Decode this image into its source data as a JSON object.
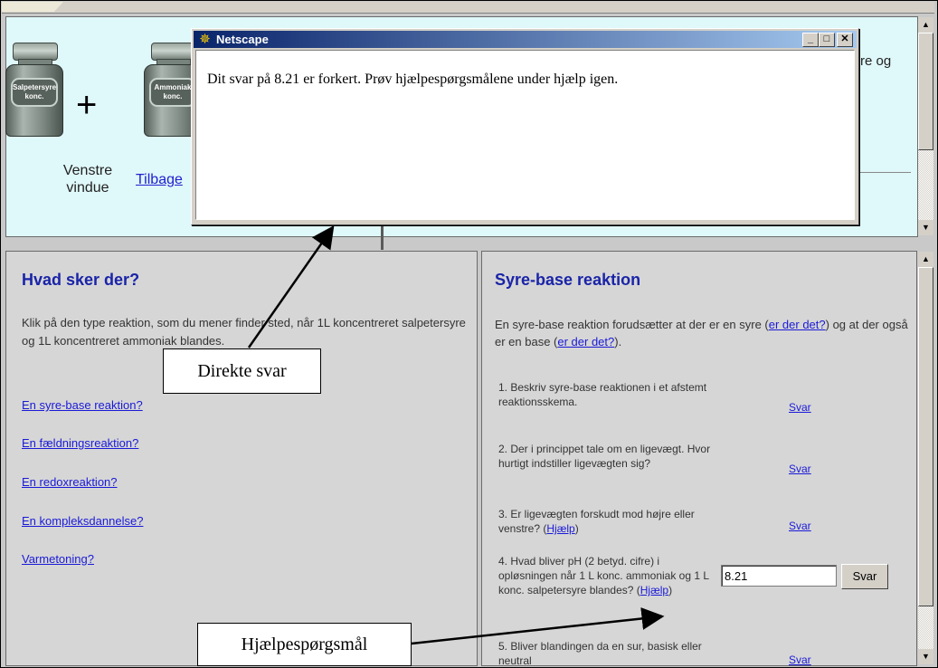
{
  "popup": {
    "title": "Netscape",
    "message": "Dit svar på 8.21 er forkert. Prøv hjælpespørgsmålene under hjælp igen."
  },
  "top": {
    "bottle1_label": "Salpetersyre konc.",
    "bottle2_label": "Ammoniak konc.",
    "plus": "+",
    "left_window": "Venstre vindue",
    "back_link": "Tilbage",
    "partial_text": "re og"
  },
  "left": {
    "title": "Hvad sker der?",
    "text": "Klik på den type reaktion, som du mener finder sted, når 1L koncentreret salpetersyre og 1L koncentreret ammoniak blandes.",
    "links": [
      "En syre-base reaktion?",
      "En fældningsreaktion?",
      "En redoxreaktion?",
      "En kompleksdannelse?",
      "Varmetoning?"
    ]
  },
  "right": {
    "title": "Syre-base reaktion",
    "intro_a": "En syre-base reaktion forudsætter at der er en syre (",
    "intro_link1": "er der det?",
    "intro_b": ") og at der også er en base (",
    "intro_link2": "er der det?",
    "intro_c": ").",
    "questions": [
      {
        "text": "1. Beskriv syre-base reaktionen i et afstemt reaktionsskema.",
        "help": "",
        "tail": "",
        "svar": "Svar"
      },
      {
        "text": "2. Der i princippet tale om en ligevægt. Hvor hurtigt indstiller ligevægten sig?",
        "help": "",
        "tail": "",
        "svar": "Svar"
      },
      {
        "text": "3. Er ligevægten forskudt mod højre eller venstre? (",
        "help": "Hjælp",
        "tail": ")",
        "svar": "Svar"
      },
      {
        "text": "4. Hvad bliver pH (2 betyd. cifre) i opløsningen når 1 L konc. ammoniak og 1 L konc. salpetersyre blandes? (",
        "help": "Hjælp",
        "tail": ")",
        "svar": "Svar"
      },
      {
        "text": "5. Bliver blandingen da en sur, basisk eller neutral",
        "help": "",
        "tail": "",
        "svar": "Svar"
      }
    ],
    "answer_value": "8.21",
    "answer_button": "Svar"
  },
  "annotations": {
    "direct": "Direkte svar",
    "help": "Hjælpespørgsmål"
  },
  "colors": {
    "top_frame_bg": "#dff8fa",
    "heading": "#1a24a8",
    "link": "#1a1ad8",
    "titlebar": "#0a246a"
  }
}
